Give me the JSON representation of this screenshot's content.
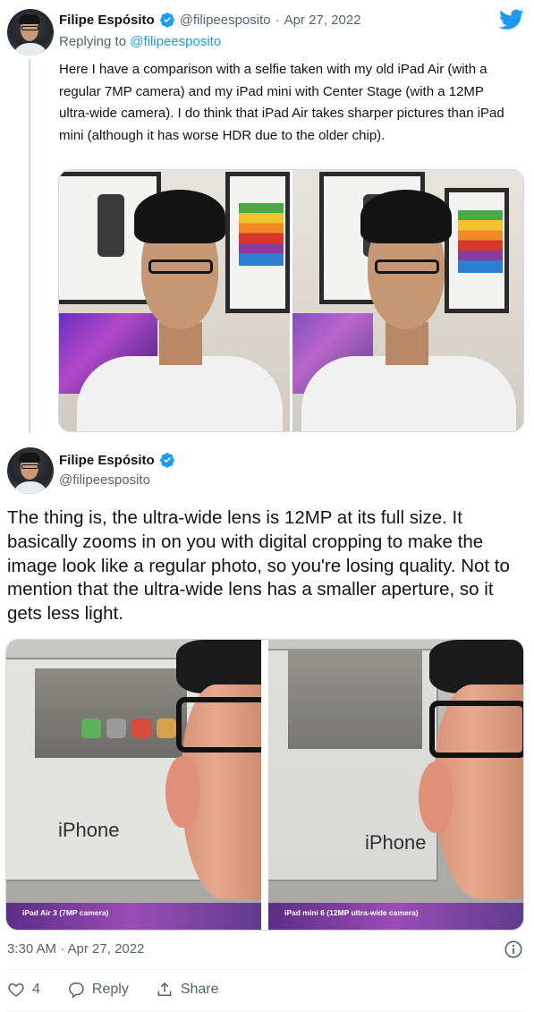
{
  "tweet1": {
    "author_name": "Filipe Espósito",
    "author_handle": "@filipeesposito",
    "separator": "·",
    "date": "Apr 27, 2022",
    "replying_prefix": "Replying to ",
    "replying_to": "@filipeesposito",
    "text": "Here I have a comparison with a selfie taken with my old iPad Air (with a regular 7MP camera) and my iPad mini with Center Stage (with a 12MP ultra-wide camera). I do think that iPad Air takes sharper pictures than iPad mini (although it has worse HDR due to the older chip)."
  },
  "tweet2": {
    "author_name": "Filipe Espósito",
    "author_handle": "@filipeesposito",
    "text": "The thing is, the ultra-wide lens is 12MP at its full size. It basically zooms in on you with digital cropping to make the image look like a regular photo, so you're losing quality. Not to mention that the ultra-wide lens has a smaller aperture, so it gets less light.",
    "image_left_caption": "iPad Air 3 (7MP camera)",
    "image_right_caption": "iPad mini 6 (12MP ultra-wide camera)",
    "image_brand_text": "iPhone",
    "timestamp": "3:30 AM · Apr 27, 2022",
    "actions": {
      "like_count": "4",
      "reply_label": "Reply",
      "share_label": "Share"
    }
  },
  "icons": {
    "verified": "verified-badge-icon",
    "brand": "twitter-bird-icon",
    "info": "info-icon",
    "like": "heart-icon",
    "reply": "reply-bubble-icon",
    "share": "share-icon"
  },
  "colors": {
    "accent": "#1d9bf0",
    "secondary_text": "#536471",
    "primary_text": "#0f1419"
  }
}
